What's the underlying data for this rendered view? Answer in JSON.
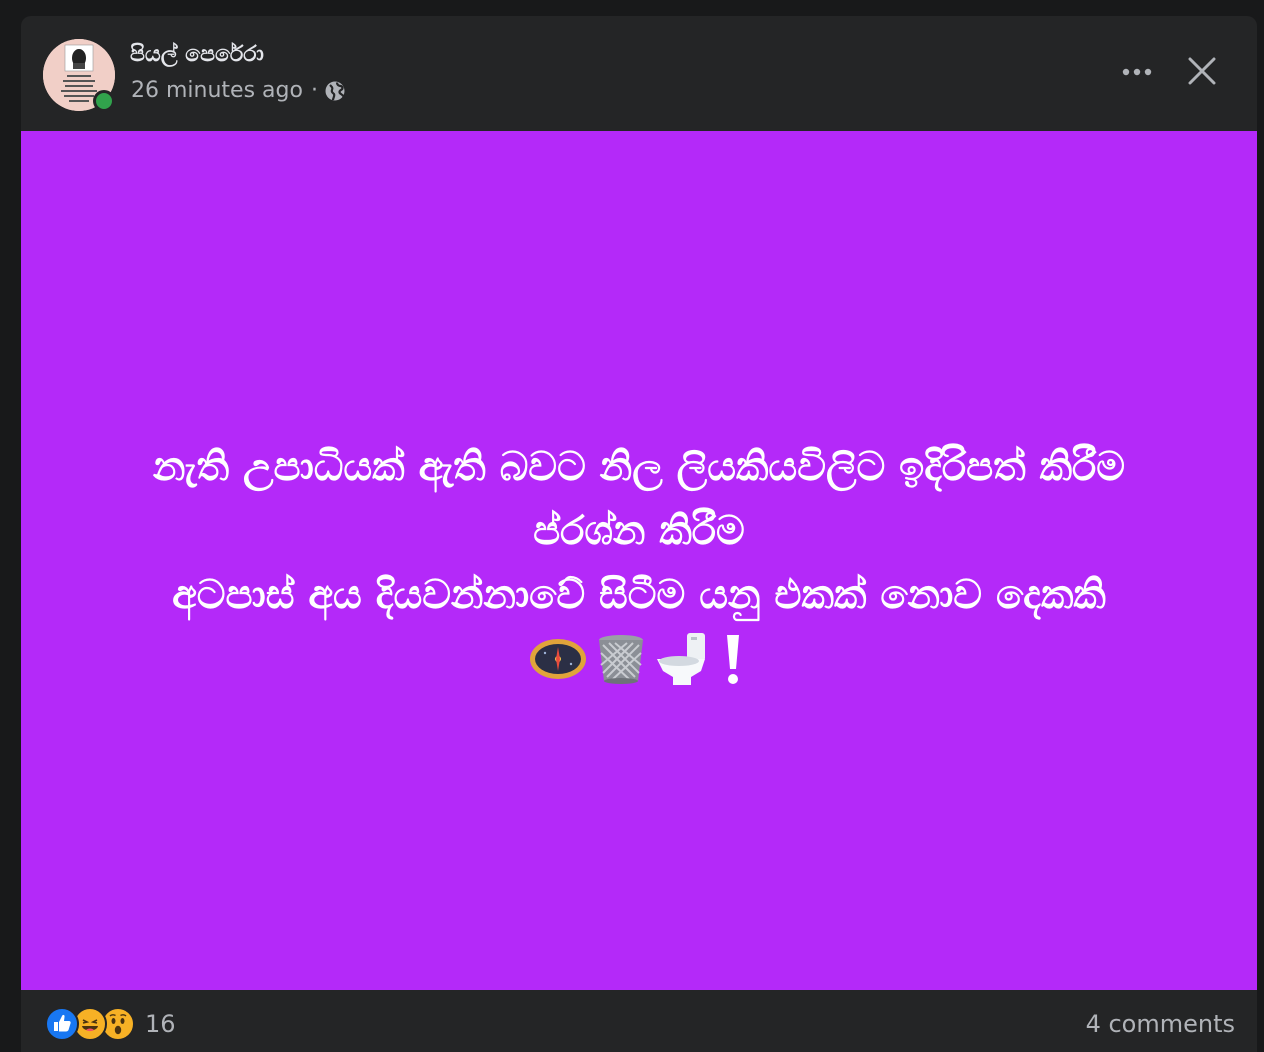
{
  "post": {
    "author": "පියල් පෙරේරා",
    "time": "26 minutes ago",
    "separator": "·",
    "privacy_icon": "globe-icon",
    "more_icon": "more-dots-icon",
    "close_icon": "close-icon",
    "background_color": "#b429f9",
    "lines": [
      "නැති උපාධියක් ඇති බවට නිල ලියකියවිලිට ඉදිරිපත් කිරීම",
      "ප්රශ්න කිරීම",
      "අටපාස් අය දියවන්නාවේ සිටීම යනු එකක් නොව දෙකකි"
    ],
    "emojis": [
      "compass-emoji",
      "wastebasket-emoji",
      "toilet-emoji",
      "exclamation-emoji"
    ]
  },
  "footer": {
    "reactions": [
      "like-reaction-icon",
      "haha-reaction-icon",
      "wow-reaction-icon"
    ],
    "reaction_count": "16",
    "comments": "4 comments"
  }
}
